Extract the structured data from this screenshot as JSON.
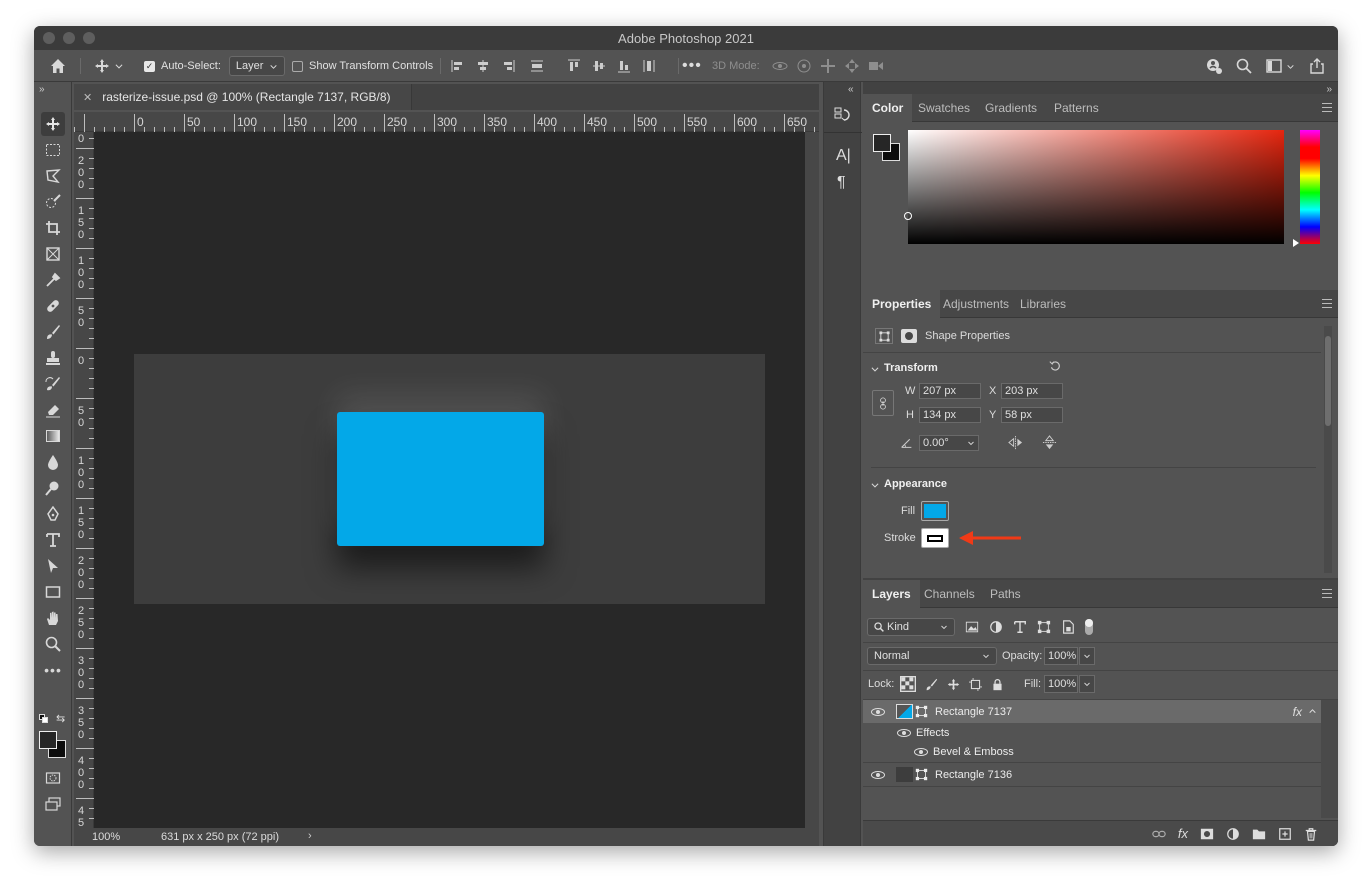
{
  "app": {
    "title": "Adobe Photoshop 2021"
  },
  "options_bar": {
    "auto_select_label": "Auto-Select:",
    "auto_select_value": "Layer",
    "show_transform_label": "Show Transform Controls",
    "mode_3d_label": "3D Mode:"
  },
  "document": {
    "tab_title": "rasterize-issue.psd @ 100% (Rectangle 7137, RGB/8)",
    "zoom": "100%",
    "doc_info": "631 px x 250 px (72 ppi)",
    "ruler_h": [
      "0",
      "50",
      "100",
      "150",
      "200",
      "250",
      "300",
      "350",
      "400",
      "450",
      "500",
      "550",
      "600",
      "650"
    ],
    "ruler_v": [
      "0",
      "200",
      "150",
      "100",
      "50",
      "0",
      "50",
      "100",
      "150",
      "200",
      "250",
      "300",
      "350",
      "400",
      "450"
    ],
    "rect_color": "#03a8e8"
  },
  "color_panel": {
    "tabs": [
      "Color",
      "Swatches",
      "Gradients",
      "Patterns"
    ]
  },
  "properties_panel": {
    "tabs": [
      "Properties",
      "Adjustments",
      "Libraries"
    ],
    "heading": "Shape Properties",
    "transform_label": "Transform",
    "w_label": "W",
    "w_value": "207 px",
    "h_label": "H",
    "h_value": "134 px",
    "x_label": "X",
    "x_value": "203 px",
    "y_label": "Y",
    "y_value": "58 px",
    "angle_value": "0.00°",
    "appearance_label": "Appearance",
    "fill_label": "Fill",
    "fill_color": "#03a8e8",
    "stroke_label": "Stroke"
  },
  "layers_panel": {
    "tabs": [
      "Layers",
      "Channels",
      "Paths"
    ],
    "filter_kind": "Kind",
    "blend_mode": "Normal",
    "opacity_label": "Opacity:",
    "opacity_value": "100%",
    "lock_label": "Lock:",
    "fill_label": "Fill:",
    "fill_value": "100%",
    "layers": [
      {
        "name": "Rectangle 7137",
        "fx": "fx"
      },
      {
        "name": "Rectangle 7136"
      }
    ],
    "effects_label": "Effects",
    "effect_name": "Bevel & Emboss"
  },
  "mini_dock": {
    "char_label": "A|",
    "para_label": "¶"
  },
  "annotation": {
    "arrow_color": "#f03a17"
  }
}
